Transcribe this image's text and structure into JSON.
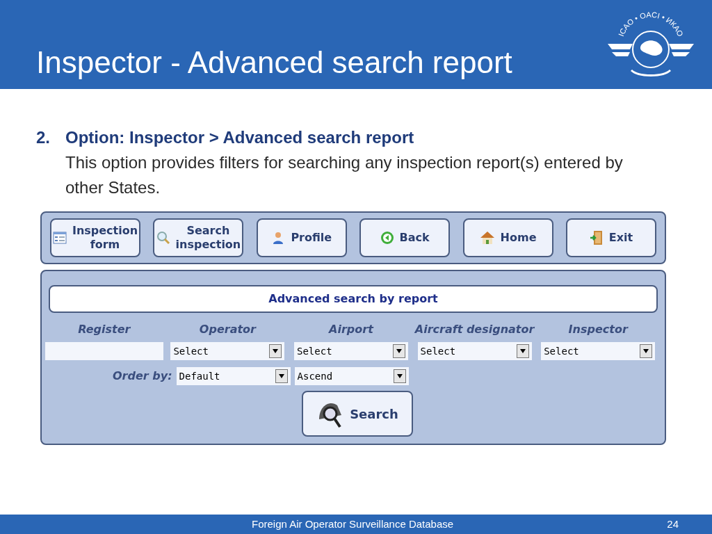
{
  "slide": {
    "title": "Inspector - Advanced search report",
    "logo_text": "ICAO • OACI • ИКАО"
  },
  "item": {
    "number": "2.",
    "heading": "Option: Inspector > Advanced search report",
    "text": "This option provides filters for searching any inspection report(s) entered by other States."
  },
  "toolbar": [
    {
      "label": "Inspection form",
      "kind": "form"
    },
    {
      "label": "Search inspection",
      "kind": "search"
    },
    {
      "label": "Profile",
      "kind": "person"
    },
    {
      "label": "Back",
      "kind": "back"
    },
    {
      "label": "Home",
      "kind": "home"
    },
    {
      "label": "Exit",
      "kind": "exit"
    }
  ],
  "panel": {
    "title": "Advanced search by report",
    "filters": [
      {
        "label": "Register",
        "kind": "text"
      },
      {
        "label": "Operator",
        "kind": "select",
        "value": "Select"
      },
      {
        "label": "Airport",
        "kind": "select",
        "value": "Select"
      },
      {
        "label": "Aircraft designator",
        "kind": "select",
        "value": "Select"
      },
      {
        "label": "Inspector",
        "kind": "select",
        "value": "Select"
      }
    ],
    "order_label": "Order by:",
    "order": [
      {
        "value": "Default"
      },
      {
        "value": "Ascend"
      }
    ],
    "search_button": "Search"
  },
  "footer": {
    "text": "Foreign Air Operator Surveillance Database",
    "page": "24"
  }
}
